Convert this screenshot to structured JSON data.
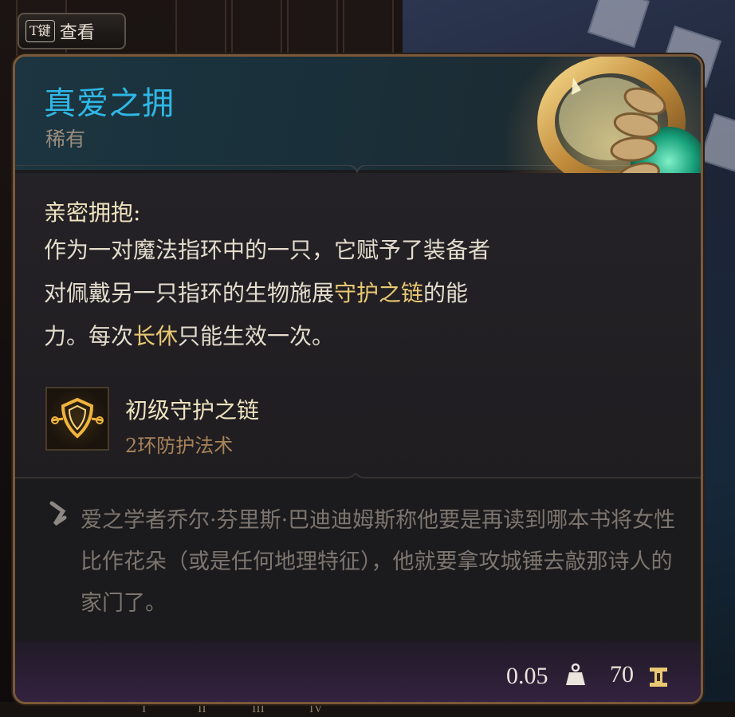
{
  "key_hint": {
    "key": "T键",
    "action": "查看"
  },
  "item": {
    "name": "真爱之拥",
    "rarity": "稀有",
    "rarity_color": "#9a8c7c",
    "name_color": "#2fb7e6",
    "icon": "ring-icon"
  },
  "passive": {
    "title": "亲密拥抱:",
    "segments": [
      {
        "text": "作为一对魔法指环中的一只，它赋予了装备者对佩戴另一只指环的生物施展",
        "highlight": false
      },
      {
        "text": "守护之链",
        "highlight": true
      },
      {
        "text": "的能力。每次",
        "highlight": false
      },
      {
        "text": "长休",
        "highlight": true
      },
      {
        "text": "只能生效一次。",
        "highlight": false
      }
    ],
    "highlight_color": "#e9c873"
  },
  "spell": {
    "name": "初级守护之链",
    "level": "2环防护法术",
    "icon": "warding-bond-icon"
  },
  "lore": {
    "icon": "quill-icon",
    "text": "爱之学者乔尔·芬里斯·巴迪迪姆斯称他要是再读到哪本书将女性比作花朵（或是任何地理特征），他就要拿攻城锤去敲那诗人的家门了。"
  },
  "footer": {
    "weight": "0.05",
    "weight_icon": "weight-icon",
    "price": "70",
    "price_icon": "gold-icon"
  },
  "hotbar_labels": [
    "I",
    "II",
    "III",
    "IV"
  ]
}
